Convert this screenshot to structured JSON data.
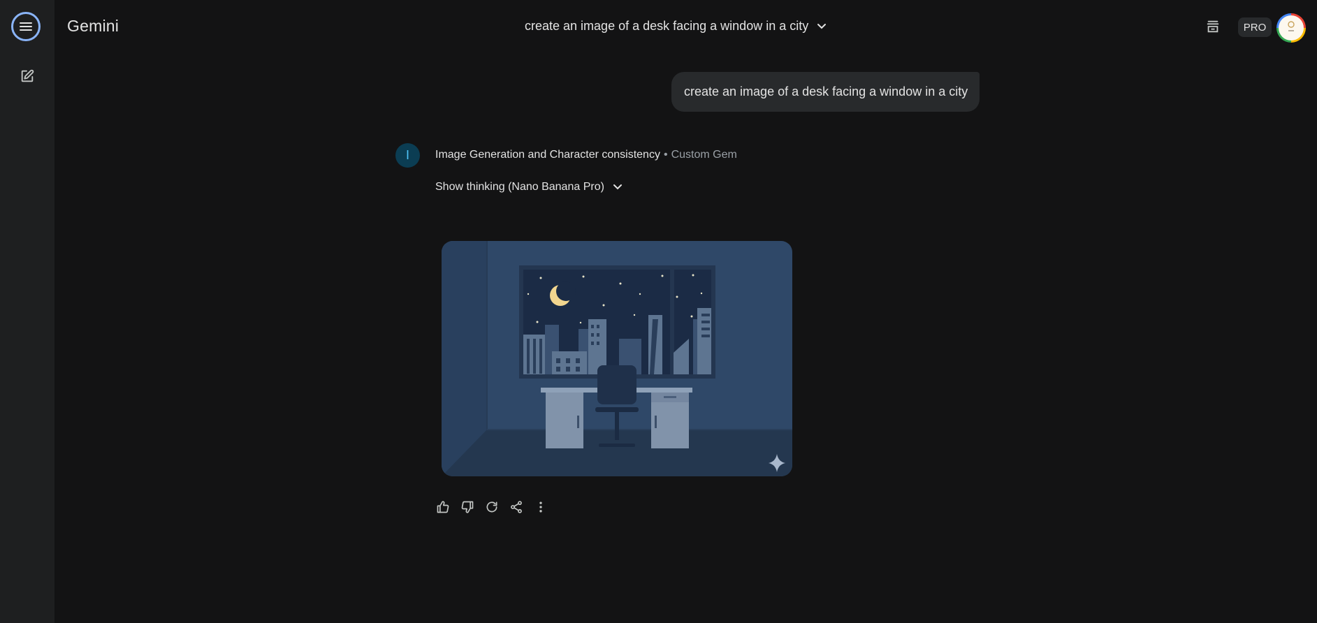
{
  "app": {
    "title": "Gemini",
    "conversation_title": "create an image of a desk facing a window in a city"
  },
  "sidebar": {
    "menu_icon": "menu-icon",
    "new_chat_icon": "edit-icon"
  },
  "header": {
    "temporary_chat_icon": "temporary-chat-icon",
    "plan_badge": "PRO",
    "avatar_icon": "profile-avatar"
  },
  "user_message": {
    "text": "create an image of a desk facing a window in a city"
  },
  "response": {
    "gem_initial": "I",
    "gem_name": "Image Generation and Character consistency",
    "separator": "•",
    "gem_type": "Custom Gem",
    "thinking_label": "Show thinking (Nano Banana Pro)",
    "image_icon": "sparkle-icon"
  },
  "actions": [
    "thumbs-up-icon",
    "thumbs-down-icon",
    "refresh-icon",
    "share-icon",
    "more-vert-icon"
  ],
  "colors": {
    "background": "#131314",
    "sidebar": "#1e1f20",
    "bubble": "#282a2c",
    "focus_ring": "#8ab4f8",
    "gem_avatar": "#0b3d53"
  }
}
